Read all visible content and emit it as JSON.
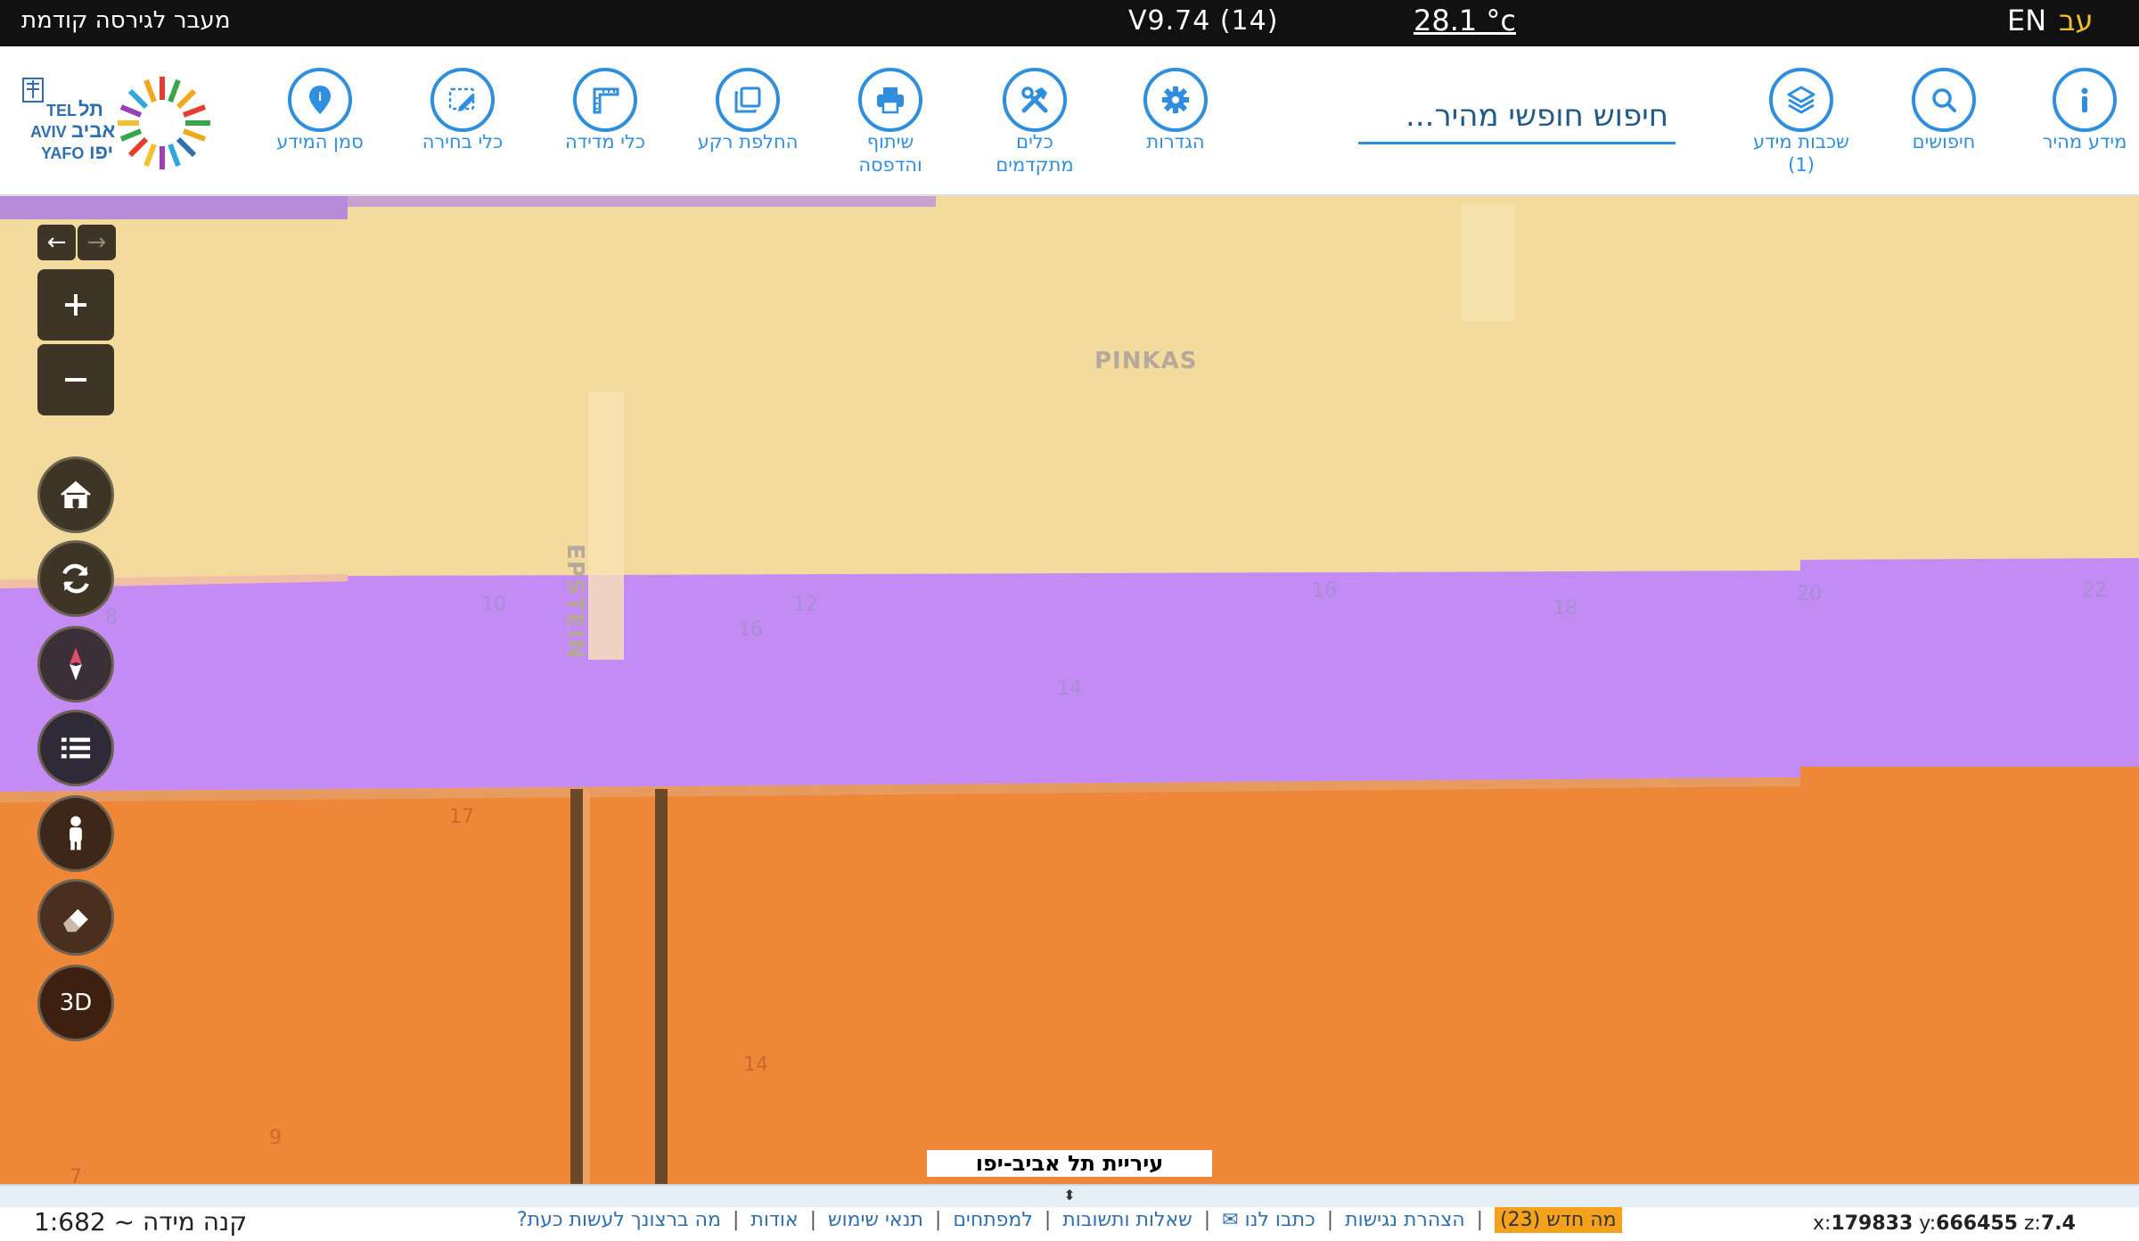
{
  "topbar": {
    "prev_version": "מעבר לגירסה קודמת",
    "version": "V9.74 (14)",
    "temperature": "28.1 °c",
    "lang_en": "EN",
    "lang_he": "עב"
  },
  "toolbar": {
    "info_marker": "סמן המידע",
    "selection_tools": "כלי בחירה",
    "measure_tools": "כלי מדידה",
    "switch_background": "החלפת רקע",
    "share_print_1": "שיתוף",
    "share_print_2": "והדפסה",
    "advanced_tools_1": "כלים",
    "advanced_tools_2": "מתקדמים",
    "settings": "הגדרות",
    "search_placeholder": "חיפוש חופשי מהיר...",
    "layers_1": "שכבות מידע",
    "layers_2": "(1)",
    "searches": "חיפושים",
    "quick_info": "מידע מהיר"
  },
  "map": {
    "street_pinkas": "PINKAS",
    "street_epstein": "EPSTEIN",
    "numbers": [
      "10",
      "12",
      "16",
      "16",
      "18",
      "20",
      "22",
      "8",
      "14",
      "17",
      "14",
      "9",
      "7"
    ],
    "city_label": "עיריית תל אביב-יפו",
    "controls": {
      "zoom_in": "+",
      "zoom_out": "−",
      "mode_3d": "3D"
    },
    "colors": {
      "residential": "#f3db9d",
      "purple_zone": "#c58bf5",
      "orange_zone": "#ee8838"
    }
  },
  "footer": {
    "scale": "קנה מידה ~ 1:682",
    "links": [
      "מה ברצונך לעשות כעת?",
      "אודות",
      "תנאי שימוש",
      "למפתחים",
      "שאלות ותשובות",
      "כתבו לנו ✉",
      "הצהרת נגישות"
    ],
    "whats_new": "מה חדש (23)",
    "coords": {
      "x_label": "x:",
      "x": "179833",
      "y_label": "y:",
      "y": "666455",
      "z_label": "z:",
      "z": "7.4"
    }
  }
}
